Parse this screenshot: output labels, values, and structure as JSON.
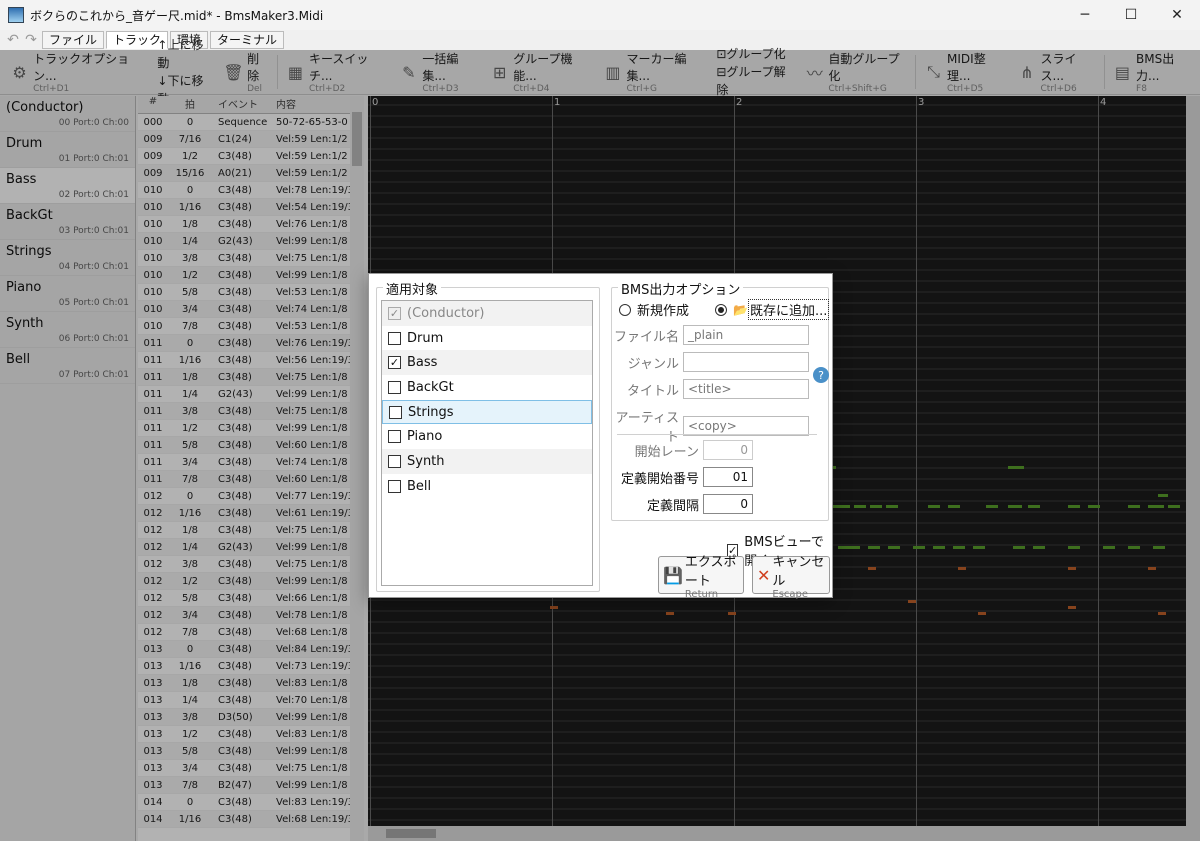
{
  "window": {
    "title": "ボクらのこれから_音ゲー尺.mid* - BmsMaker3.Midi",
    "minimize": "─",
    "maximize": "☐",
    "close": "✕"
  },
  "menu": {
    "undo_icon": "↶",
    "redo_icon": "↷",
    "tabs": [
      "ファイル",
      "トラック",
      "環境",
      "ターミナル"
    ]
  },
  "toolbar": {
    "track_options": {
      "label": "トラックオプション...",
      "shortcut": "Ctrl+D1"
    },
    "move_up": "上に移動",
    "move_down": "下に移動",
    "delete": {
      "label": "削除",
      "shortcut": "Del"
    },
    "key_switch": {
      "label": "キースイッチ...",
      "shortcut": "Ctrl+D2"
    },
    "bulk_edit": {
      "label": "一括編集...",
      "shortcut": "Ctrl+D3"
    },
    "group_func": {
      "label": "グループ機能...",
      "shortcut": "Ctrl+D4"
    },
    "marker_edit": {
      "label": "マーカー編集...",
      "shortcut": "Ctrl+G"
    },
    "group": "グループ化",
    "ungroup": "グループ解除",
    "auto_group": {
      "label": "自動グループ化",
      "shortcut": "Ctrl+Shift+G"
    },
    "midi_tidy": {
      "label": "MIDI整理...",
      "shortcut": "Ctrl+D5"
    },
    "slice": {
      "label": "スライス...",
      "shortcut": "Ctrl+D6"
    },
    "bms_out": {
      "label": "BMS出力...",
      "shortcut": "F8"
    }
  },
  "tracks": [
    {
      "name": "(Conductor)",
      "info": "00 Port:0 Ch:00"
    },
    {
      "name": "Drum",
      "info": "01 Port:0 Ch:01"
    },
    {
      "name": "Bass",
      "info": "02 Port:0 Ch:01"
    },
    {
      "name": "BackGt",
      "info": "03 Port:0 Ch:01"
    },
    {
      "name": "Strings",
      "info": "04 Port:0 Ch:01"
    },
    {
      "name": "Piano",
      "info": "05 Port:0 Ch:01"
    },
    {
      "name": "Synth",
      "info": "06 Port:0 Ch:01"
    },
    {
      "name": "Bell",
      "info": "07 Port:0 Ch:01"
    }
  ],
  "event_headers": [
    "#",
    "拍",
    "イベント",
    "内容"
  ],
  "events": [
    [
      "000",
      "0",
      "Sequence",
      "50-72-65-53-0"
    ],
    [
      "009",
      "7/16",
      "C1(24)",
      "Vel:59 Len:1/2"
    ],
    [
      "009",
      "1/2",
      "C3(48)",
      "Vel:59 Len:1/2"
    ],
    [
      "009",
      "15/16",
      "A0(21)",
      "Vel:59 Len:1/2"
    ],
    [
      "010",
      "0",
      "C3(48)",
      "Vel:78 Len:19/3"
    ],
    [
      "010",
      "1/16",
      "C3(48)",
      "Vel:54 Len:19/3"
    ],
    [
      "010",
      "1/8",
      "C3(48)",
      "Vel:76 Len:1/8"
    ],
    [
      "010",
      "1/4",
      "G2(43)",
      "Vel:99 Len:1/8"
    ],
    [
      "010",
      "3/8",
      "C3(48)",
      "Vel:75 Len:1/8"
    ],
    [
      "010",
      "1/2",
      "C3(48)",
      "Vel:99 Len:1/8"
    ],
    [
      "010",
      "5/8",
      "C3(48)",
      "Vel:53 Len:1/8"
    ],
    [
      "010",
      "3/4",
      "C3(48)",
      "Vel:74 Len:1/8"
    ],
    [
      "010",
      "7/8",
      "C3(48)",
      "Vel:53 Len:1/8"
    ],
    [
      "011",
      "0",
      "C3(48)",
      "Vel:76 Len:19/3"
    ],
    [
      "011",
      "1/16",
      "C3(48)",
      "Vel:56 Len:19/3"
    ],
    [
      "011",
      "1/8",
      "C3(48)",
      "Vel:75 Len:1/8"
    ],
    [
      "011",
      "1/4",
      "G2(43)",
      "Vel:99 Len:1/8"
    ],
    [
      "011",
      "3/8",
      "C3(48)",
      "Vel:75 Len:1/8"
    ],
    [
      "011",
      "1/2",
      "C3(48)",
      "Vel:99 Len:1/8"
    ],
    [
      "011",
      "5/8",
      "C3(48)",
      "Vel:60 Len:1/8"
    ],
    [
      "011",
      "3/4",
      "C3(48)",
      "Vel:74 Len:1/8"
    ],
    [
      "011",
      "7/8",
      "C3(48)",
      "Vel:60 Len:1/8"
    ],
    [
      "012",
      "0",
      "C3(48)",
      "Vel:77 Len:19/3"
    ],
    [
      "012",
      "1/16",
      "C3(48)",
      "Vel:61 Len:19/3"
    ],
    [
      "012",
      "1/8",
      "C3(48)",
      "Vel:75 Len:1/8"
    ],
    [
      "012",
      "1/4",
      "G2(43)",
      "Vel:99 Len:1/8"
    ],
    [
      "012",
      "3/8",
      "C3(48)",
      "Vel:75 Len:1/8"
    ],
    [
      "012",
      "1/2",
      "C3(48)",
      "Vel:99 Len:1/8"
    ],
    [
      "012",
      "5/8",
      "C3(48)",
      "Vel:66 Len:1/8"
    ],
    [
      "012",
      "3/4",
      "C3(48)",
      "Vel:78 Len:1/8"
    ],
    [
      "012",
      "7/8",
      "C3(48)",
      "Vel:68 Len:1/8"
    ],
    [
      "013",
      "0",
      "C3(48)",
      "Vel:84 Len:19/3"
    ],
    [
      "013",
      "1/16",
      "C3(48)",
      "Vel:73 Len:19/3"
    ],
    [
      "013",
      "1/8",
      "C3(48)",
      "Vel:83 Len:1/8"
    ],
    [
      "013",
      "1/4",
      "C3(48)",
      "Vel:70 Len:1/8"
    ],
    [
      "013",
      "3/8",
      "D3(50)",
      "Vel:99 Len:1/8"
    ],
    [
      "013",
      "1/2",
      "C3(48)",
      "Vel:83 Len:1/8"
    ],
    [
      "013",
      "5/8",
      "C3(48)",
      "Vel:99 Len:1/8"
    ],
    [
      "013",
      "3/4",
      "C3(48)",
      "Vel:75 Len:1/8"
    ],
    [
      "013",
      "7/8",
      "B2(47)",
      "Vel:99 Len:1/8"
    ],
    [
      "014",
      "0",
      "C3(48)",
      "Vel:83 Len:19/3"
    ],
    [
      "014",
      "1/16",
      "C3(48)",
      "Vel:68 Len:19/3"
    ]
  ],
  "roll": {
    "bar_labels": [
      "0",
      "1",
      "2",
      "3",
      "4"
    ],
    "note_colors": {
      "green": "#5aa02c",
      "orange": "#c0602a"
    }
  },
  "dialog": {
    "targets_legend": "適用対象",
    "targets": [
      {
        "name": "(Conductor)",
        "checked": true,
        "disabled": true
      },
      {
        "name": "Drum",
        "checked": false
      },
      {
        "name": "Bass",
        "checked": true
      },
      {
        "name": "BackGt",
        "checked": false
      },
      {
        "name": "Strings",
        "checked": false,
        "highlighted": true
      },
      {
        "name": "Piano",
        "checked": false
      },
      {
        "name": "Synth",
        "checked": false
      },
      {
        "name": "Bell",
        "checked": false
      }
    ],
    "options_legend": "BMS出力オプション",
    "radio_new": "新規作成",
    "radio_append": "既存に追加...",
    "radio_selected": "append",
    "folder_icon": "📂",
    "filename_label": "ファイル名",
    "filename_value": "_plain",
    "genre_label": "ジャンル",
    "genre_value": "",
    "title_label": "タイトル",
    "title_value": "<title>",
    "artist_label": "アーティスト",
    "artist_value": "<copy>",
    "help_icon": "?",
    "start_lane_label": "開始レーン",
    "start_lane_value": "0",
    "def_start_label": "定義開始番号",
    "def_start_value": "01",
    "def_interval_label": "定義間隔",
    "def_interval_value": "0",
    "open_bms_view_label": "BMSビューで開く",
    "open_bms_view_checked": true,
    "export_button": {
      "label": "エクスポート",
      "shortcut": "Return"
    },
    "cancel_button": {
      "label": "キャンセル",
      "shortcut": "Escape"
    }
  }
}
